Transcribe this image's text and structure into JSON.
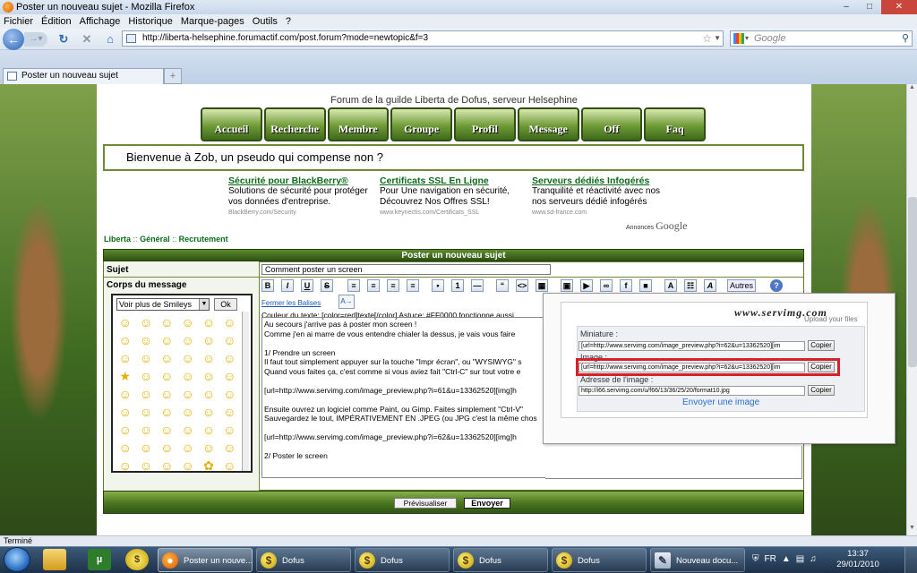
{
  "window": {
    "title": "Poster un nouveau sujet - Mozilla Firefox"
  },
  "menu": [
    "Fichier",
    "Édition",
    "Affichage",
    "Historique",
    "Marque-pages",
    "Outils",
    "?"
  ],
  "url": "http://liberta-helsephine.forumactif.com/post.forum?mode=newtopic&f=3",
  "search_placeholder": "Google",
  "tab": {
    "title": "Poster un nouveau sujet",
    "new_tab": "+"
  },
  "forum": {
    "title": "Forum de la guilde Liberta de Dofus, serveur Helsephine",
    "nav": [
      "Accueil",
      "Recherche",
      "Membre",
      "Groupe",
      "Profil",
      "Message",
      "Off",
      "Faq"
    ],
    "welcome": "Bienvenue à Zob, un pseudo qui compense non ?"
  },
  "ads": [
    {
      "title": "Sécurité pour BlackBerry®",
      "line1": "Solutions de sécurité pour protéger",
      "line2": "vos données d'entreprise.",
      "url": "BlackBerry.com/Security"
    },
    {
      "title": "Certificats SSL En Ligne",
      "line1": "Pour Une navigation en sécurité,",
      "line2": "Découvrez Nos Offres SSL!",
      "url": "www.keynectis.com/Certificats_SSL"
    },
    {
      "title": "Serveurs dédiés Infogérés",
      "line1": "Tranquilité et réactivité avec nos",
      "line2": "nos serveurs dédié infogérés",
      "url": "www.sd-france.com"
    }
  ],
  "ads_label": "Annonces",
  "ads_brand": "Google",
  "breadcrumb": {
    "a": "Liberta",
    "b": "Général",
    "c": "Recrutement",
    "sep": "::"
  },
  "post": {
    "header": "Poster un nouveau sujet",
    "label_subject": "Sujet",
    "label_body": "Corps du message",
    "subject_value": "Comment poster un screen",
    "smiley_select": "Voir plus de Smileys",
    "smiley_ok": "Ok",
    "autres": "Autres",
    "help": "?",
    "fermer": "Fermer les Balises",
    "color_line": "Couleur du texte: [color=red]texte[/color]  Astuce: #FF0000 fonctionne aussi",
    "body_lines": [
      "Au secours j'arrive pas à poster mon screen !",
      "Comme j'en ai marre de vous entendre chialer la dessus, je vais vous faire",
      "",
      "  1/ Prendre un screen",
      "Il faut tout simplement appuyer sur la touche \"Impr écran\", ou \"WYSIWYG\" s",
      "Quand vous faites ça, c'est comme si vous aviez fait \"Ctrl-C\" sur tout votre e",
      "",
      "[url=http://www.servimg.com/image_preview.php?i=61&u=13362520][img]h",
      "",
      "Ensuite ouvrez un logiciel comme Paint, ou Gimp. Faites simplement \"Ctrl-V\"",
      "Sauvegardez le tout, IMPÉRATIVEMENT EN .JPEG (ou JPG c'est la même chos",
      "",
      "[url=http://www.servimg.com/image_preview.php?i=62&u=13362520][img]h",
      "",
      "  2/ Poster le screen"
    ],
    "preview_button": "Prévisualiser",
    "send_button": "Envoyer"
  },
  "servimg": {
    "logo": "www.servimg.com",
    "subtitle": "Upload your files",
    "label_thumb": "Miniature :",
    "label_image": "Image :",
    "label_address": "Adresse de l'image :",
    "thumb_value": "[url=http://www.servimg.com/image_preview.php?i=62&u=13362520][im",
    "image_value": "[url=http://www.servimg.com/image_preview.php?i=62&u=13362520][im",
    "address_value": "http://i66.servimg.com/u/f66/13/36/25/20/format10.jpg",
    "copy": "Copier",
    "send_link": "Envoyer une image"
  },
  "status": "Terminé",
  "taskbar": {
    "items": [
      "Poster un nouve...",
      "Dofus",
      "Dofus",
      "Dofus",
      "Dofus",
      "Nouveau docu..."
    ],
    "lang": "FR",
    "time": "13:37",
    "date": "29/01/2010"
  }
}
